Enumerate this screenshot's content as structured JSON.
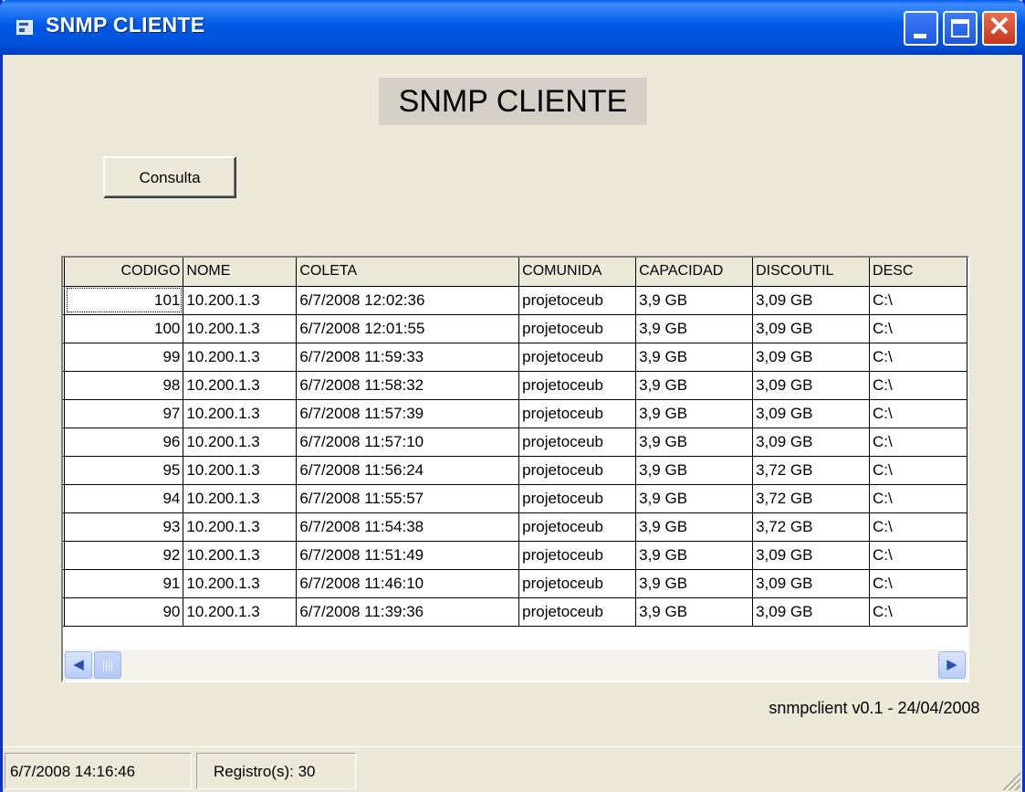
{
  "window": {
    "title": "SNMP CLIENTE",
    "colors": {
      "titlebar": "#0058e6",
      "close_button": "#d9441f",
      "face": "#ece9d8"
    }
  },
  "heading": "SNMP CLIENTE",
  "consulta_button": "Consulta",
  "grid": {
    "columns": [
      "CODIGO",
      "NOME",
      "COLETA",
      "COMUNIDA",
      "CAPACIDAD",
      "DISCOUTIL",
      "DESC"
    ],
    "rows": [
      [
        "101",
        "10.200.1.3",
        "6/7/2008 12:02:36",
        "projetoceub",
        "3,9 GB",
        "3,09 GB",
        "C:\\"
      ],
      [
        "100",
        "10.200.1.3",
        "6/7/2008 12:01:55",
        "projetoceub",
        "3,9 GB",
        "3,09 GB",
        "C:\\"
      ],
      [
        "99",
        "10.200.1.3",
        "6/7/2008 11:59:33",
        "projetoceub",
        "3,9 GB",
        "3,09 GB",
        "C:\\"
      ],
      [
        "98",
        "10.200.1.3",
        "6/7/2008 11:58:32",
        "projetoceub",
        "3,9 GB",
        "3,09 GB",
        "C:\\"
      ],
      [
        "97",
        "10.200.1.3",
        "6/7/2008 11:57:39",
        "projetoceub",
        "3,9 GB",
        "3,09 GB",
        "C:\\"
      ],
      [
        "96",
        "10.200.1.3",
        "6/7/2008 11:57:10",
        "projetoceub",
        "3,9 GB",
        "3,09 GB",
        "C:\\"
      ],
      [
        "95",
        "10.200.1.3",
        "6/7/2008 11:56:24",
        "projetoceub",
        "3,9 GB",
        "3,72 GB",
        "C:\\"
      ],
      [
        "94",
        "10.200.1.3",
        "6/7/2008 11:55:57",
        "projetoceub",
        "3,9 GB",
        "3,72 GB",
        "C:\\"
      ],
      [
        "93",
        "10.200.1.3",
        "6/7/2008 11:54:38",
        "projetoceub",
        "3,9 GB",
        "3,72 GB",
        "C:\\"
      ],
      [
        "92",
        "10.200.1.3",
        "6/7/2008 11:51:49",
        "projetoceub",
        "3,9 GB",
        "3,09 GB",
        "C:\\"
      ],
      [
        "91",
        "10.200.1.3",
        "6/7/2008 11:46:10",
        "projetoceub",
        "3,9 GB",
        "3,09 GB",
        "C:\\"
      ],
      [
        "90",
        "10.200.1.3",
        "6/7/2008 11:39:36",
        "projetoceub",
        "3,9 GB",
        "3,09 GB",
        "C:\\"
      ]
    ],
    "icons": {
      "scroll_up": "arrow-up-icon",
      "scroll_down": "arrow-down-icon",
      "scroll_left": "arrow-left-icon",
      "scroll_right": "arrow-right-icon"
    }
  },
  "version_label": "snmpclient v0.1 - 24/04/2008",
  "status": {
    "datetime": "6/7/2008 14:16:46",
    "records": "Registro(s): 30"
  }
}
